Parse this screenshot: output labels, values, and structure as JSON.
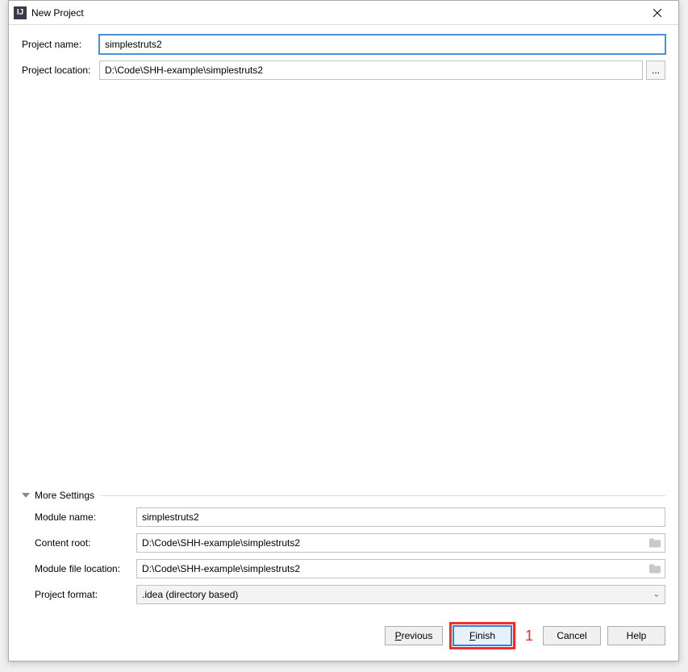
{
  "window": {
    "title": "New Project",
    "app_icon_text": "IJ"
  },
  "top_form": {
    "project_name_label": "Project name:",
    "project_name_value": "simplestruts2",
    "project_location_label": "Project location:",
    "project_location_value": "D:\\Code\\SHH-example\\simplestruts2",
    "browse_label": "..."
  },
  "more_settings": {
    "header": "More Settings",
    "module_name_label": "Module name:",
    "module_name_value": "simplestruts2",
    "content_root_label": "Content root:",
    "content_root_value": "D:\\Code\\SHH-example\\simplestruts2",
    "module_file_loc_label": "Module file location:",
    "module_file_loc_value": "D:\\Code\\SHH-example\\simplestruts2",
    "project_format_label": "Project format:",
    "project_format_value": ".idea (directory based)"
  },
  "buttons": {
    "previous": "Previous",
    "finish": "Finish",
    "cancel": "Cancel",
    "help": "Help"
  },
  "annotations": {
    "finish_marker": "1"
  }
}
